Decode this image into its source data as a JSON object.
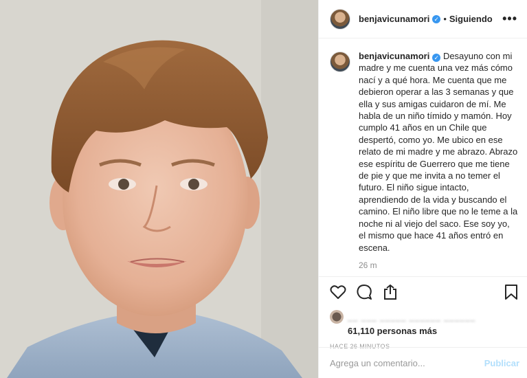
{
  "photo": {
    "subject": "boy-portrait"
  },
  "header": {
    "username": "benjavicunamori",
    "verified_symbol": "✓",
    "separator": "•",
    "follow_status": "Siguiendo",
    "more_symbol": "•••"
  },
  "caption": {
    "username": "benjavicunamori",
    "text": "Desayuno con mi madre y me cuenta una vez más cómo nací y a qué hora. Me cuenta que me debieron operar a las 3 semanas y que ella y sus amigas cuidaron de mí. Me habla de un niño tímido y mamón. Hoy cumplo 41 años en un Chile que despertó, como yo. Me ubico en ese relato de mi madre y me abrazo. Abrazo ese espíritu de Guerrero que me tiene de pie y que me invita a no temer el futuro. El niño sigue intacto, aprendiendo de la vida y buscando el camino. El niño libre que no le teme a la noche ni al viejo del saco. Ese soy yo, el mismo que hace 41 años entró en escena.",
    "time": "26 m"
  },
  "actions": {
    "icons": [
      "heart-icon",
      "comment-icon",
      "share-icon",
      "bookmark-icon"
    ]
  },
  "likes": {
    "liked_by_blurred": "__ ___ _____ ______ ______",
    "count": "61,110",
    "suffix": "personas más",
    "ago": "HACE 26 MINUTOS"
  },
  "comment": {
    "placeholder": "Agrega un comentario...",
    "publish_label": "Publicar"
  },
  "colors": {
    "accent": "#3897f0",
    "publish_disabled": "#b2dffc",
    "text": "#262626",
    "muted": "#8e8e8e"
  }
}
